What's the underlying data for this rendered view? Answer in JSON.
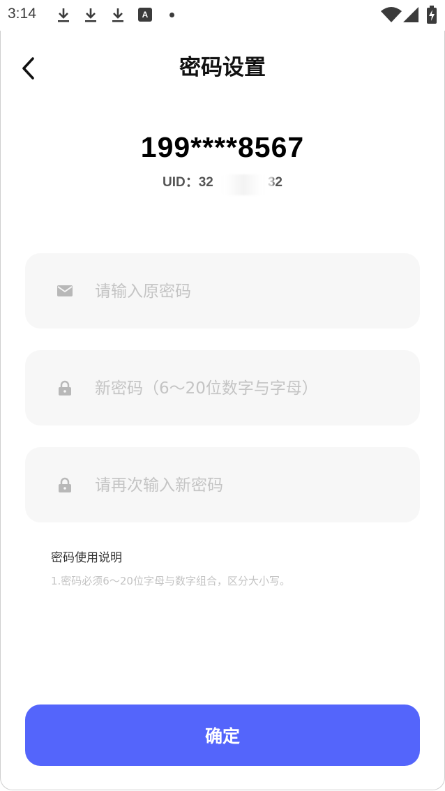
{
  "status_bar": {
    "time": "3:14",
    "app_icon_letter": "A",
    "icons": [
      "download-icon",
      "download-icon",
      "download-icon",
      "app-notification-icon",
      "dot-icon",
      "wifi-icon",
      "signal-icon",
      "battery-charging-icon"
    ]
  },
  "header": {
    "title": "密码设置",
    "back_icon": "chevron-left-icon"
  },
  "account": {
    "phone": "199****8567",
    "uid_label": "UID：",
    "uid_visible_start": "32",
    "uid_visible_end": "32"
  },
  "form": {
    "old_password": {
      "placeholder": "请输入原密码",
      "value": "",
      "icon": "envelope-icon"
    },
    "new_password": {
      "placeholder": "新密码（6～20位数字与字母）",
      "value": "",
      "icon": "lock-icon"
    },
    "confirm_password": {
      "placeholder": "请再次输入新密码",
      "value": "",
      "icon": "lock-icon"
    }
  },
  "rules": {
    "title": "密码使用说明",
    "text": "1.密码必须6～20位字母与数字组合，区分大小写。"
  },
  "confirm_button": {
    "label": "确定"
  },
  "colors": {
    "accent": "#5465fb",
    "field_bg": "#f7f7f7",
    "placeholder": "#c4c4c4",
    "icon_gray": "#b8b8b8"
  }
}
